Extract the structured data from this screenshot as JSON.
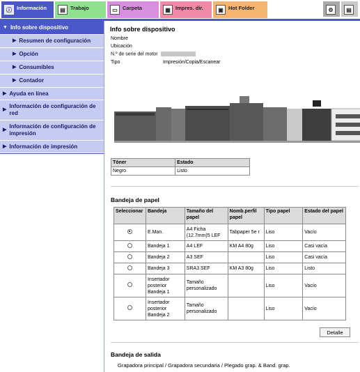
{
  "tabs": [
    {
      "label": "Información"
    },
    {
      "label": "Trabajo"
    },
    {
      "label": "Carpeta"
    },
    {
      "label": "Impres. dir."
    },
    {
      "label": "Hot Folder"
    }
  ],
  "sidebar": {
    "items": [
      {
        "label": "Info sobre dispositivo"
      },
      {
        "label": "Resumen de configuración"
      },
      {
        "label": "Opción"
      },
      {
        "label": "Consumibles"
      },
      {
        "label": "Contador"
      },
      {
        "label": "Ayuda en línea"
      },
      {
        "label": "Información de configuración de red"
      },
      {
        "label": "Información de configuración de impresión"
      },
      {
        "label": "Información de impresión"
      }
    ]
  },
  "device": {
    "title": "Info sobre dispositivo",
    "fields": [
      {
        "label": "Nombre",
        "value": ""
      },
      {
        "label": "Ubicación",
        "value": ""
      },
      {
        "label": "N.º de serie del motor",
        "value": ""
      },
      {
        "label": "Tipo",
        "value": "Impresión/Copia/Escanear"
      }
    ]
  },
  "toner": {
    "headers": [
      "Tóner",
      "Estado"
    ],
    "rows": [
      [
        "Negro",
        "Listo"
      ]
    ]
  },
  "paper_tray": {
    "title": "Bandeja de papel",
    "headers": [
      "Seleccionar",
      "Bandeja",
      "Tamaño del papel",
      "Nomb.perfil papel",
      "Tipo papel",
      "Estado del papel"
    ],
    "rows": [
      {
        "selected": true,
        "tray": "E.Man.",
        "size": "A4 Ficha (12.7mm)5 LEF",
        "profile": "Tabpaper 5e r",
        "type": "Liso",
        "status": "Vacío"
      },
      {
        "selected": false,
        "tray": "Bandeja 1",
        "size": "A4 LEF",
        "profile": "KM A4 80g",
        "type": "Liso",
        "status": "Casi vacía"
      },
      {
        "selected": false,
        "tray": "Bandeja 2",
        "size": "A3 SEF",
        "profile": "",
        "type": "Liso",
        "status": "Casi vacía"
      },
      {
        "selected": false,
        "tray": "Bandeja 3",
        "size": "SRA3 SEF",
        "profile": "KM A3 80g",
        "type": "Liso",
        "status": "Listo"
      },
      {
        "selected": false,
        "tray": "Insertador posterior Bandeja 1",
        "size": "Tamaño personalizado",
        "profile": "",
        "type": "Liso",
        "status": "Vacío"
      },
      {
        "selected": false,
        "tray": "Insertador posterior Bandeja 2",
        "size": "Tamaño personalizado",
        "profile": "",
        "type": "Liso",
        "status": "Vacío"
      }
    ],
    "detail_button": "Detalle"
  },
  "output_tray": {
    "title": "Bandeja de salida",
    "text": "Grapadora principal / Grapadora secundaria / Plegado grap. & Band. grap."
  }
}
